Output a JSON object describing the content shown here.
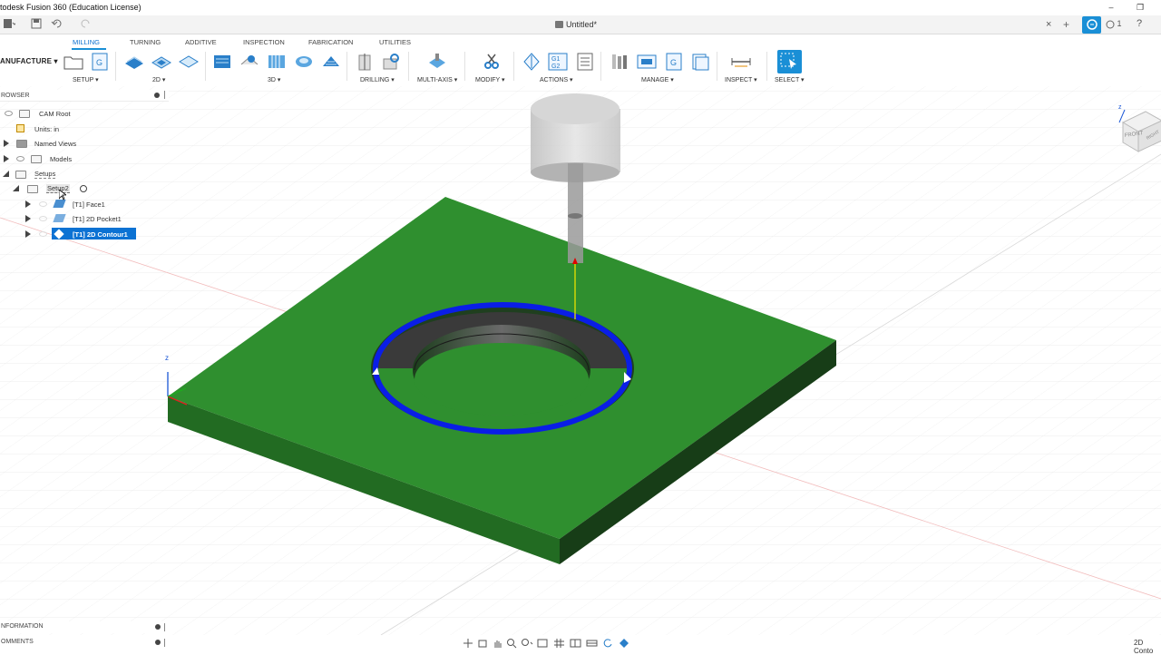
{
  "window": {
    "app_title": "todesk Fusion 360 (Education License)",
    "minimize": "–",
    "restore": "❐"
  },
  "tabbar": {
    "doc_title": "Untitled*",
    "close": "×",
    "new_tab": "+",
    "jobs": "1",
    "help": "?"
  },
  "toolbar": {
    "workspace": "ANUFACTURE ▾",
    "tabs": [
      "MILLING",
      "TURNING",
      "ADDITIVE",
      "INSPECTION",
      "FABRICATION",
      "UTILITIES"
    ],
    "groups": {
      "setup": "SETUP ▾",
      "twod": "2D ▾",
      "threed": "3D ▾",
      "drilling": "DRILLING ▾",
      "multi_axis": "MULTI-AXIS ▾",
      "modify": "MODIFY ▾",
      "actions": "ACTIONS ▾",
      "manage": "MANAGE ▾",
      "inspect": "INSPECT ▾",
      "select": "SELECT ▾"
    }
  },
  "browser": {
    "header": "ROWSER",
    "items": [
      {
        "label": "CAM Root"
      },
      {
        "label": "Units: in"
      },
      {
        "label": "Named Views"
      },
      {
        "label": "Models"
      },
      {
        "label": "Setups"
      },
      {
        "label": "Setup2"
      },
      {
        "label": "[T1] Face1"
      },
      {
        "label": "[T1] 2D Pocket1"
      },
      {
        "label": "[T1] 2D Contour1"
      }
    ]
  },
  "bottom_panels": {
    "information": "NFORMATION",
    "comments": "OMMENTS"
  },
  "viewcube": {
    "front": "FRONT",
    "right": "RIGHT"
  },
  "status": {
    "text": "2D Conto"
  },
  "colors": {
    "accent": "#1a8fd6",
    "stock_top": "#2e8b2e",
    "toolpath": "#0a1ee6"
  }
}
